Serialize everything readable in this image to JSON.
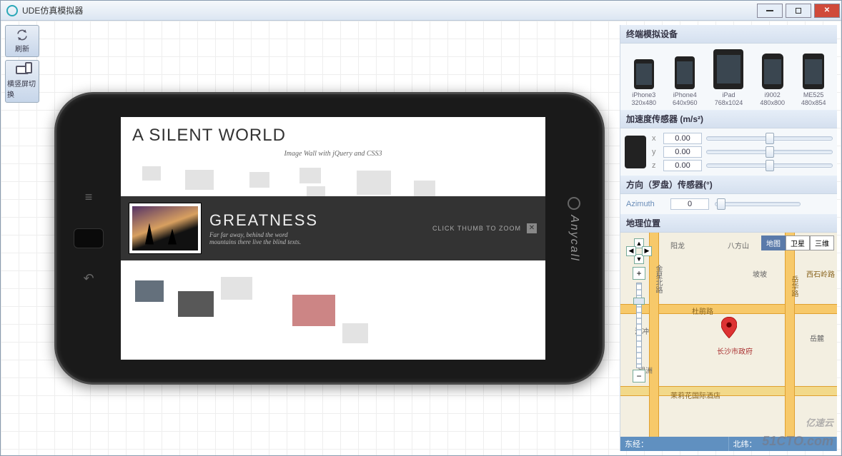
{
  "title": "UDE仿真模拟器",
  "toolbar": {
    "refresh_label": "刷新",
    "rotate_label": "横竖屏切换"
  },
  "phone_content": {
    "title": "A SILENT WORLD",
    "subtitle": "Image Wall with jQuery and CSS3",
    "feature_title": "GREATNESS",
    "feature_desc": "Far far away, behind the word mountains there live the blind texts.",
    "feature_hint": "CLICK THUMB TO ZOOM",
    "brand": "Anycall"
  },
  "devices_header": "终端模拟设备",
  "devices": [
    {
      "name": "iPhone3",
      "res": "320x480"
    },
    {
      "name": "iPhone4",
      "res": "640x960"
    },
    {
      "name": "iPad",
      "res": "768x1024"
    },
    {
      "name": "i9002",
      "res": "480x800"
    },
    {
      "name": "ME525",
      "res": "480x854"
    }
  ],
  "accel": {
    "header": "加速度传感器 (m/s²)",
    "axes": [
      {
        "axis": "x",
        "value": "0.00"
      },
      {
        "axis": "y",
        "value": "0.00"
      },
      {
        "axis": "z",
        "value": "0.00"
      }
    ]
  },
  "compass": {
    "header": "方向（罗盘）传感器(°)",
    "label": "Azimuth",
    "value": "0"
  },
  "geo": {
    "header": "地理位置",
    "modes": {
      "map": "地图",
      "sat": "卫星",
      "three": "三维"
    },
    "roads": {
      "dujuan": "杜鹃路",
      "yuehua": "岳华路",
      "xishiling": "西石岭路",
      "maoli": "茉莉花国际酒店",
      "yueli": "岳麓",
      "changsha": "长沙市政府",
      "jinxing": "金星北路",
      "bafang": "八方山",
      "pobo": "坡坡",
      "eryuan": "泥冲",
      "yinzhou": "银洲",
      "yanglong": "阳龙"
    },
    "footer": {
      "lng": "东经：",
      "lat": "北纬："
    }
  },
  "watermark1": "51CTO.com",
  "watermark2": "亿速云"
}
